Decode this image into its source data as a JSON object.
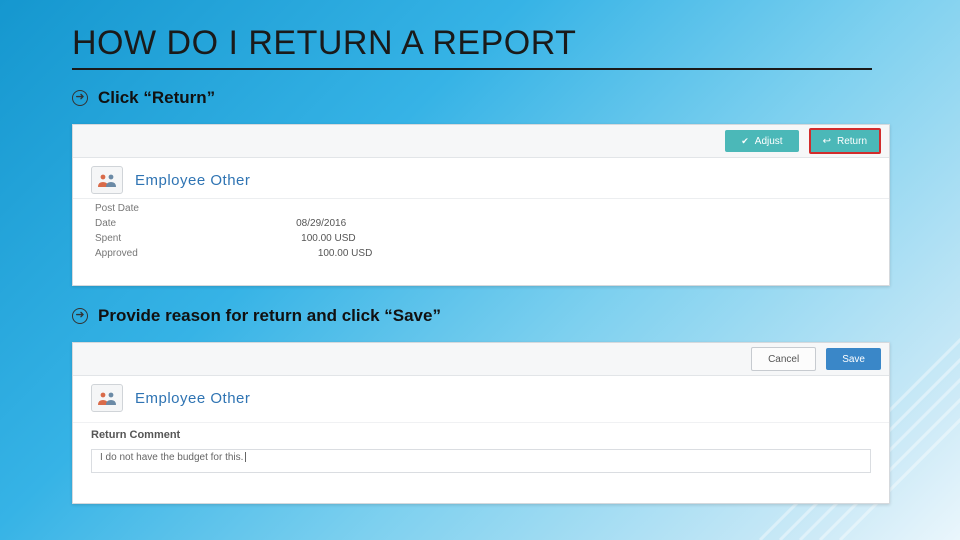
{
  "title": "HOW DO I RETURN A REPORT",
  "bullets": {
    "b1": "Click “Return”",
    "b2": "Provide reason for return and click “Save”"
  },
  "shot1": {
    "adjust_btn": "Adjust",
    "return_btn": "Return",
    "section_title": "Employee Other",
    "rows": {
      "post_date_label": "Post Date",
      "date_label": "Date",
      "date_value": "08/29/2016",
      "spent_label": "Spent",
      "spent_value": "100.00 USD",
      "approved_label": "Approved",
      "approved_value": "100.00 USD"
    }
  },
  "shot2": {
    "cancel_btn": "Cancel",
    "save_btn": "Save",
    "section_title": "Employee Other",
    "return_comment_label": "Return Comment",
    "return_comment_value": "I do not have the budget for this."
  }
}
